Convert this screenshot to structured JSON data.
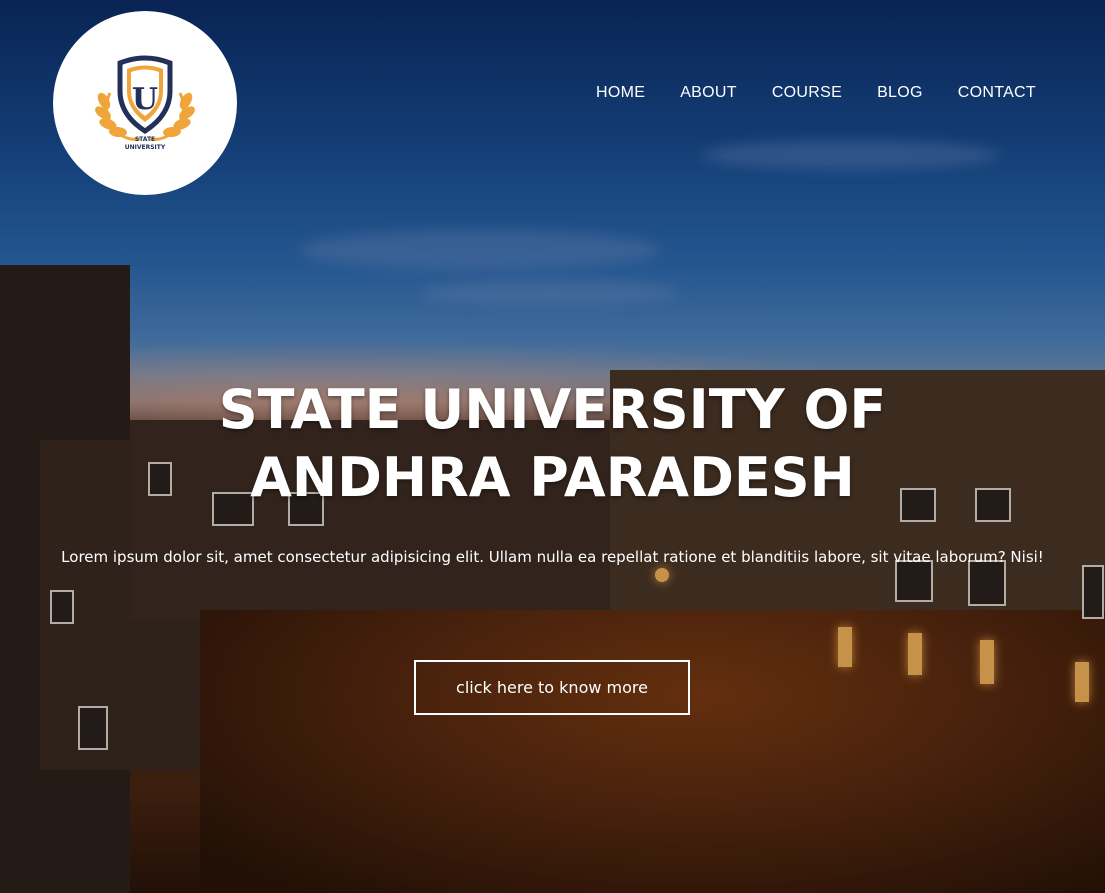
{
  "logo": {
    "letter": "U",
    "text_line1": "STATE",
    "text_line2": "UNIVERSITY",
    "colors": {
      "shield": "#23305a",
      "laurel": "#f0a53a"
    }
  },
  "nav": {
    "items": [
      {
        "label": "HOME"
      },
      {
        "label": "ABOUT"
      },
      {
        "label": "COURSE"
      },
      {
        "label": "BLOG"
      },
      {
        "label": "CONTACT"
      }
    ]
  },
  "hero": {
    "title": "STATE UNIVERSITY OF ANDHRA PARADESH",
    "description": "Lorem ipsum dolor sit, amet consectetur adipisicing elit. Ullam nulla ea repellat ratione et blanditiis labore, sit vitae laborum? Nisi!",
    "cta_label": "click here to know more"
  }
}
